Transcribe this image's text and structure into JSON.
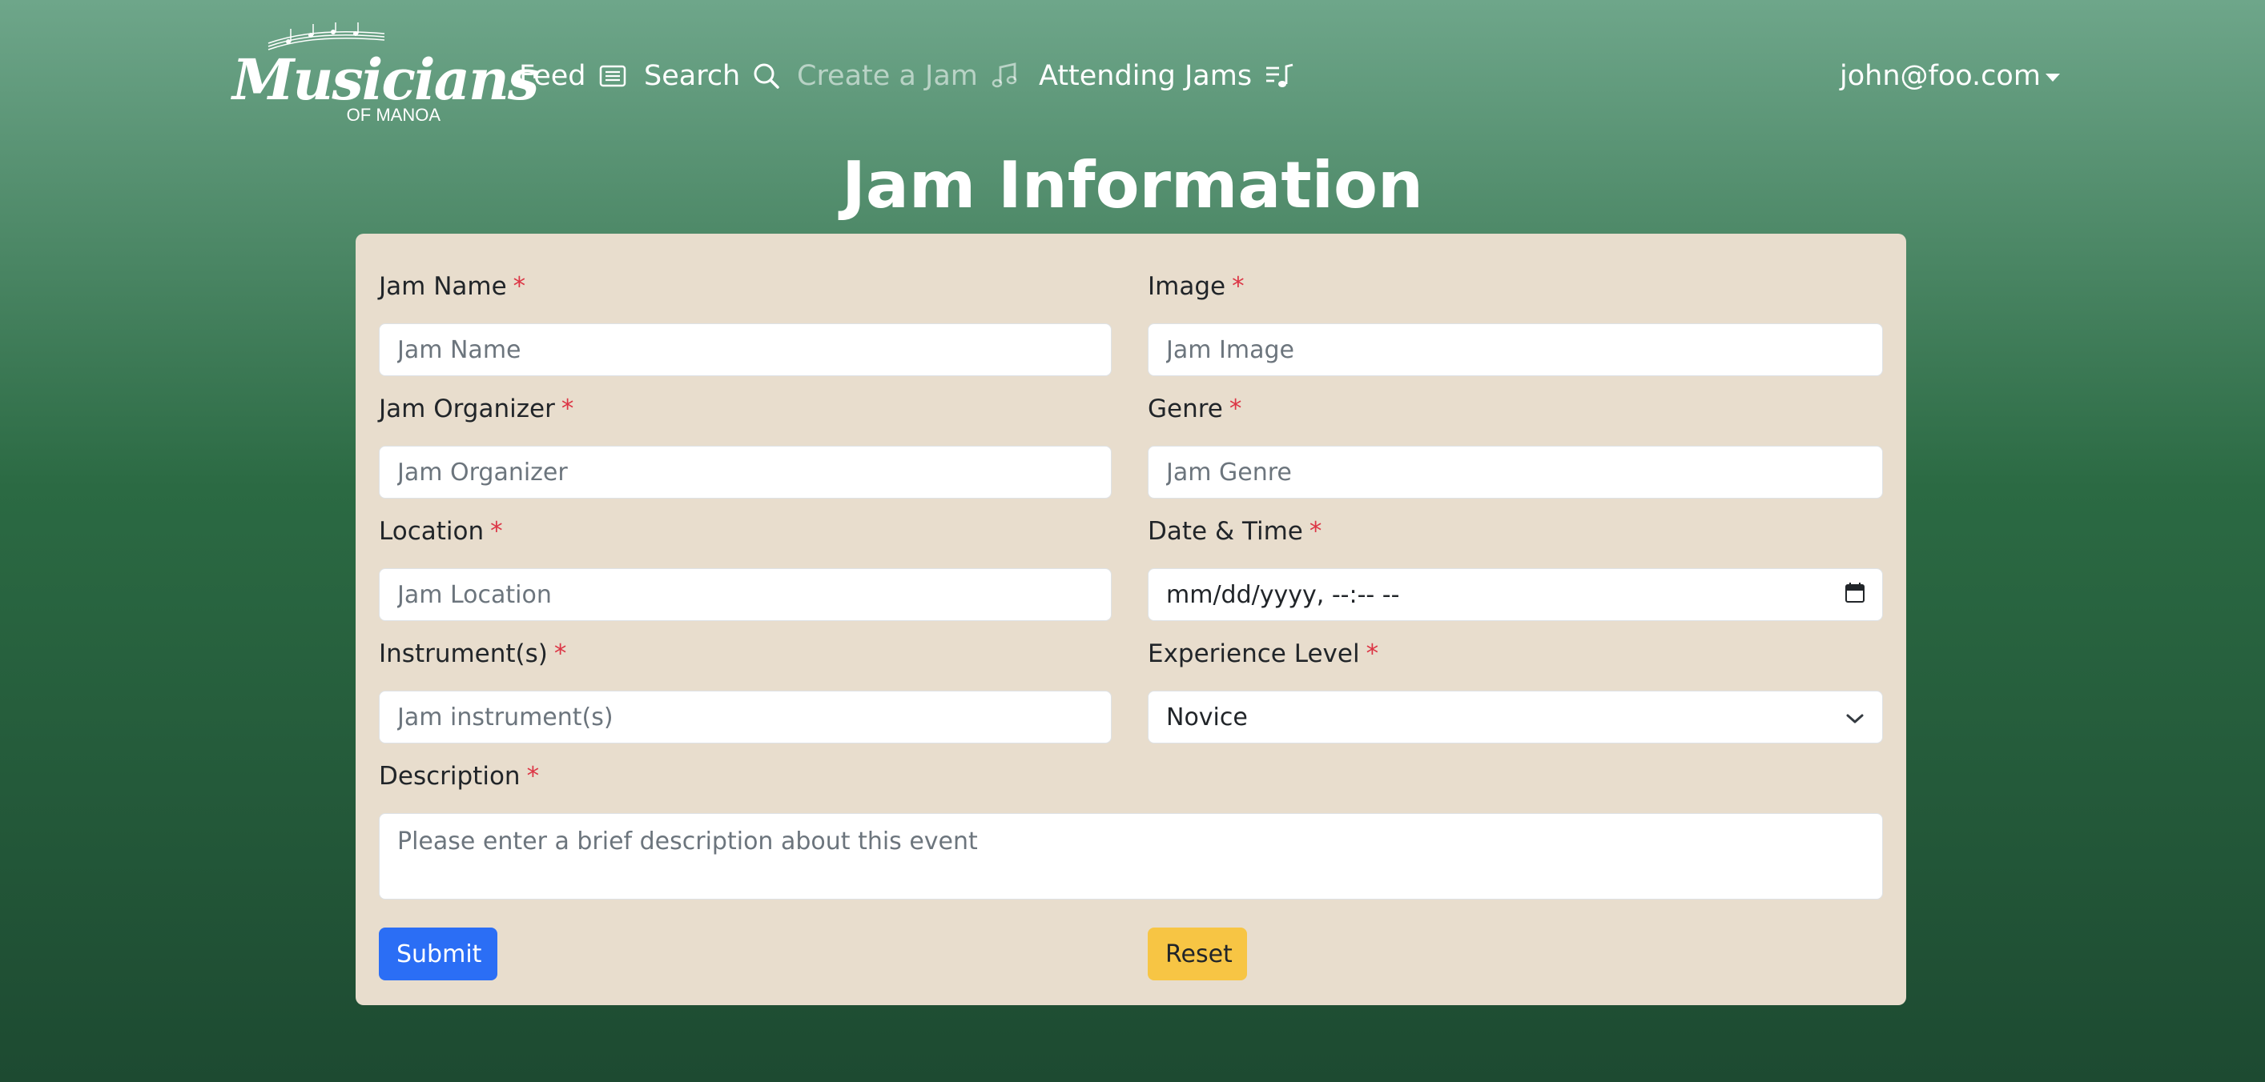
{
  "nav": {
    "logo_text": "Musicians",
    "logo_sub": "OF MANOA",
    "feed": "Feed",
    "search": "Search",
    "create_jam": "Create a Jam",
    "attending": "Attending Jams",
    "user": "john@foo.com"
  },
  "page": {
    "title": "Jam Information"
  },
  "form": {
    "jam_name": {
      "label": "Jam Name",
      "placeholder": "Jam Name"
    },
    "image": {
      "label": "Image",
      "placeholder": "Jam Image"
    },
    "organizer": {
      "label": "Jam Organizer",
      "placeholder": "Jam Organizer"
    },
    "genre": {
      "label": "Genre",
      "placeholder": "Jam Genre"
    },
    "location": {
      "label": "Location",
      "placeholder": "Jam Location"
    },
    "datetime": {
      "label": "Date & Time",
      "value": "mm/dd/yyyy, --:-- --"
    },
    "instruments": {
      "label": "Instrument(s)",
      "placeholder": "Jam instrument(s)"
    },
    "experience": {
      "label": "Experience Level",
      "value": "Novice"
    },
    "description": {
      "label": "Description",
      "placeholder": "Please enter a brief description about this event"
    },
    "required_mark": "*",
    "submit": "Submit",
    "reset": "Reset"
  },
  "colors": {
    "card_bg": "#e8ddcd",
    "submit_bg": "#2b6ef5",
    "reset_bg": "#f7c544",
    "required": "#dc3545"
  },
  "icons": [
    "newspaper-icon",
    "search-icon",
    "music-note-icon",
    "music-playlist-icon",
    "calendar-icon",
    "chevron-down-icon",
    "caret-down-icon"
  ]
}
